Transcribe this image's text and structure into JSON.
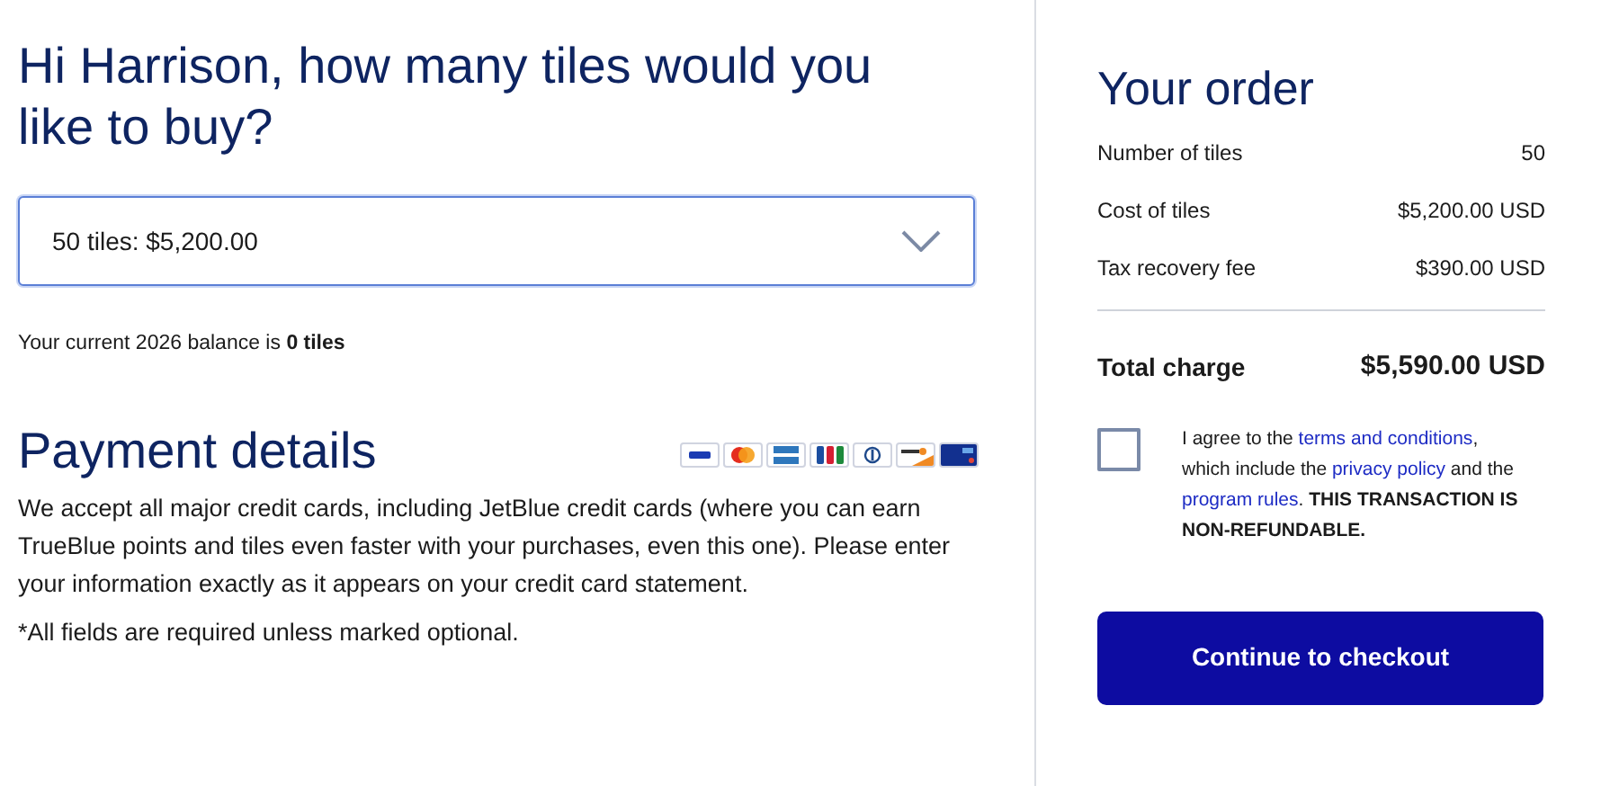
{
  "heading": "Hi Harrison, how many tiles would you like to buy?",
  "tile_select": {
    "value": "50 tiles: $5,200.00"
  },
  "balance": "Your current 2026 balance is **0 tiles**",
  "payment": {
    "title": "Payment details",
    "cards": [
      {
        "kind": "visa"
      },
      {
        "kind": "mastercard"
      },
      {
        "kind": "amex"
      },
      {
        "kind": "jcb"
      },
      {
        "kind": "diners"
      },
      {
        "kind": "discover"
      },
      {
        "kind": "jetblue"
      }
    ],
    "description": "We accept all major credit cards, including JetBlue credit cards (where you can earn TrueBlue points and tiles even faster with your purchases, even this one). Please enter your information exactly as it appears on your credit card statement.",
    "note": "*All fields are required unless marked optional."
  },
  "order": {
    "title": "Your order",
    "rows": [
      {
        "label": "Number of tiles",
        "value": "50"
      },
      {
        "label": "Cost of tiles",
        "value": "$5,200.00 USD"
      },
      {
        "label": "Tax recovery fee",
        "value": "$390.00 USD"
      }
    ],
    "total": {
      "label": "Total charge",
      "value": "$5,590.00 USD"
    },
    "agree": {
      "checked": false,
      "parts": [
        {
          "kind": "text",
          "text": "I agree to the "
        },
        {
          "kind": "link",
          "text": "terms and conditions"
        },
        {
          "kind": "text",
          "text": ", which include the "
        },
        {
          "kind": "link",
          "text": "privacy policy"
        },
        {
          "kind": "text",
          "text": " and the "
        },
        {
          "kind": "link",
          "text": "program rules"
        },
        {
          "kind": "text",
          "text": ". "
        },
        {
          "kind": "strong",
          "text": "THIS TRANSACTION IS NON-REFUNDABLE."
        }
      ]
    },
    "button": "Continue to checkout"
  }
}
